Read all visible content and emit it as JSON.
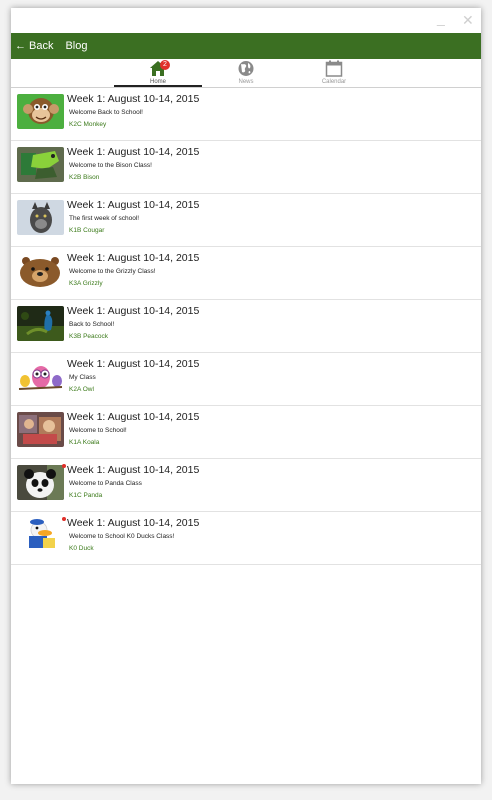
{
  "window": {
    "minimize_glyph": "_",
    "close_glyph": "✕"
  },
  "appbar": {
    "back_label": "Back",
    "title": "Blog",
    "bar_color": "#3b6f22"
  },
  "tabs": [
    {
      "label": "Home",
      "icon": "home-icon",
      "active": true,
      "badge": "2"
    },
    {
      "label": "News",
      "icon": "globe-icon",
      "active": false
    },
    {
      "label": "Calendar",
      "icon": "calendar-icon",
      "active": false
    }
  ],
  "posts": [
    {
      "title": "Week 1: August 10-14, 2015",
      "subtitle": "Welcome Back to School!",
      "class_name": "K2C Monkey",
      "thumb": "monkey",
      "unread": false
    },
    {
      "title": "Week 1: August 10-14, 2015",
      "subtitle": "Welcome to the Bison Class!",
      "class_name": "K2B Bison",
      "thumb": "bison",
      "unread": false
    },
    {
      "title": "Week 1: August 10-14, 2015",
      "subtitle": "The first week of school!",
      "class_name": "K1B Cougar",
      "thumb": "cougar",
      "unread": false
    },
    {
      "title": "Week 1: August 10-14, 2015",
      "subtitle": "Welcome to the Grizzly Class!",
      "class_name": "K3A Grizzly",
      "thumb": "grizzly",
      "unread": false
    },
    {
      "title": "Week 1: August 10-14, 2015",
      "subtitle": "Back to School!",
      "class_name": "K3B Peacock",
      "thumb": "peacock",
      "unread": false
    },
    {
      "title": "Week 1: August 10-14, 2015",
      "subtitle": "My Class",
      "class_name": "K2A Owl",
      "thumb": "owl",
      "unread": false
    },
    {
      "title": "Week 1: August 10-14, 2015",
      "subtitle": "Welcome to School!",
      "class_name": "K1A Koala",
      "thumb": "koala",
      "unread": false
    },
    {
      "title": "Week 1: August 10-14, 2015",
      "subtitle": "Welcome to Panda Class",
      "class_name": "K1C Panda",
      "thumb": "panda",
      "unread": true
    },
    {
      "title": "Week 1: August 10-14, 2015",
      "subtitle": "Welcome to School K0 Ducks Class!",
      "class_name": "K0 Duck",
      "thumb": "duck",
      "unread": true
    }
  ]
}
